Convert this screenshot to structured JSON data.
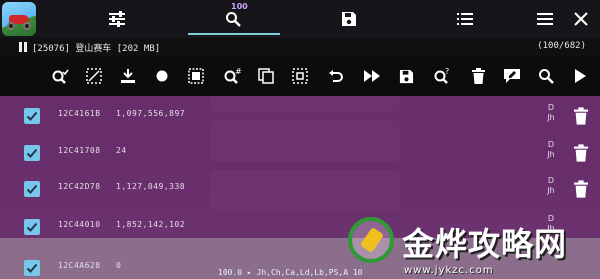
{
  "app": {
    "icon": "hill-climb-racing-app-icon"
  },
  "top_tabs": {
    "badge": "100",
    "items": [
      {
        "name": "settings-sliders-icon"
      },
      {
        "name": "search-icon"
      },
      {
        "name": "save-icon"
      },
      {
        "name": "list-icon"
      },
      {
        "name": "menu-icon"
      },
      {
        "name": "close-icon"
      }
    ]
  },
  "info": {
    "process": "[25076] 登山赛车 [202 MB]",
    "result_count": "(100/682)"
  },
  "game": {
    "paused_text": "暂停"
  },
  "toolbar_icons": [
    "search-tick-icon",
    "select-box-icon",
    "import-icon",
    "record-dot-icon",
    "select-all-icon",
    "search-plus-icon",
    "copy-icon",
    "select-inner-icon",
    "undo-icon",
    "fast-forward-icon",
    "save-icon",
    "search-help-icon",
    "delete-icon",
    "edit-tag-icon",
    "search-icon",
    "play-icon"
  ],
  "results": [
    {
      "address": "12C4161B",
      "value": "1,097,556,897",
      "flags": [
        "D",
        "Jh"
      ]
    },
    {
      "address": "12C41708",
      "value": "24",
      "flags": [
        "D",
        "Jh"
      ]
    },
    {
      "address": "12C42D78",
      "value": "1,127,049,338",
      "flags": [
        "D",
        "Jh"
      ]
    },
    {
      "address": "12C44010",
      "value": "1,852,142,102",
      "flags": [
        "D",
        "Jh"
      ]
    },
    {
      "address": "12C4A628",
      "value": "0"
    }
  ],
  "footer": "100.0 ▸ Jh,Ch,Ca,Ld,Lb,PS,A 10",
  "watermark": {
    "text": "金烨攻略网",
    "url": "www.jykzc.com"
  },
  "colors": {
    "accent": "#7ad0d8",
    "checkbox": "#78c6ea",
    "list_bg": "#6c2e70",
    "badge": "#c9a4ff"
  }
}
